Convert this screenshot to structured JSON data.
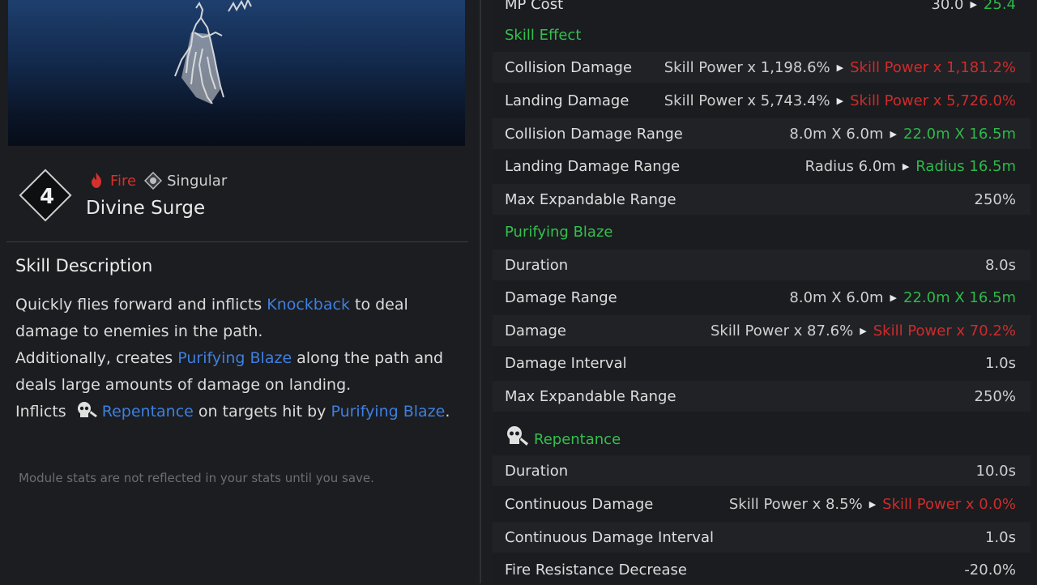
{
  "skill": {
    "level": "4",
    "element": "Fire",
    "type": "Singular",
    "name": "Divine Surge"
  },
  "description": {
    "title": "Skill Description",
    "p1_a": "Quickly flies forward and inflicts ",
    "p1_kw": "Knockback",
    "p1_b": " to deal damage to enemies in the path.",
    "p2_a": "Additionally, creates ",
    "p2_kw": "Purifying Blaze",
    "p2_b": " along the path and deals large amounts of damage on landing.",
    "p3_a": "Inflicts ",
    "p3_kw1": "Repentance",
    "p3_b": " on targets hit by ",
    "p3_kw2": "Purifying Blaze",
    "p3_c": ".",
    "note": "Module stats are not reflected in your stats until you save."
  },
  "stats": {
    "mp_cost": {
      "label": "MP Cost",
      "old": "30.0",
      "new": "25.4"
    },
    "section_skill_effect": "Skill Effect",
    "collision_damage": {
      "label": "Collision Damage",
      "old": "Skill Power x 1,198.6%",
      "new": "Skill Power x 1,181.2%"
    },
    "landing_damage": {
      "label": "Landing Damage",
      "old": "Skill Power x 5,743.4%",
      "new": "Skill Power x 5,726.0%"
    },
    "collision_damage_range": {
      "label": "Collision Damage Range",
      "old": "8.0m X 6.0m",
      "new": "22.0m X 16.5m"
    },
    "landing_damage_range": {
      "label": "Landing Damage Range",
      "old": "Radius 6.0m",
      "new": "Radius 16.5m"
    },
    "max_expandable_range_1": {
      "label": "Max Expandable Range",
      "value": "250%"
    },
    "section_purifying_blaze": "Purifying Blaze",
    "duration_1": {
      "label": "Duration",
      "value": "8.0s"
    },
    "damage_range": {
      "label": "Damage Range",
      "old": "8.0m X 6.0m",
      "new": "22.0m X 16.5m"
    },
    "damage": {
      "label": "Damage",
      "old": "Skill Power x 87.6%",
      "new": "Skill Power x 70.2%"
    },
    "damage_interval": {
      "label": "Damage Interval",
      "value": "1.0s"
    },
    "max_expandable_range_2": {
      "label": "Max Expandable Range",
      "value": "250%"
    },
    "section_repentance": "Repentance",
    "duration_2": {
      "label": "Duration",
      "value": "10.0s"
    },
    "continuous_damage": {
      "label": "Continuous Damage",
      "old": "Skill Power x 8.5%",
      "new": "Skill Power x 0.0%"
    },
    "continuous_damage_interval": {
      "label": "Continuous Damage Interval",
      "value": "1.0s"
    },
    "fire_resistance_decrease": {
      "label": "Fire Resistance Decrease",
      "value": "-20.0%"
    }
  },
  "colors": {
    "buff": "#2fb84b",
    "debuff": "#cf2b2b",
    "keyword": "#3f7fe0",
    "fire": "#d2322e"
  }
}
